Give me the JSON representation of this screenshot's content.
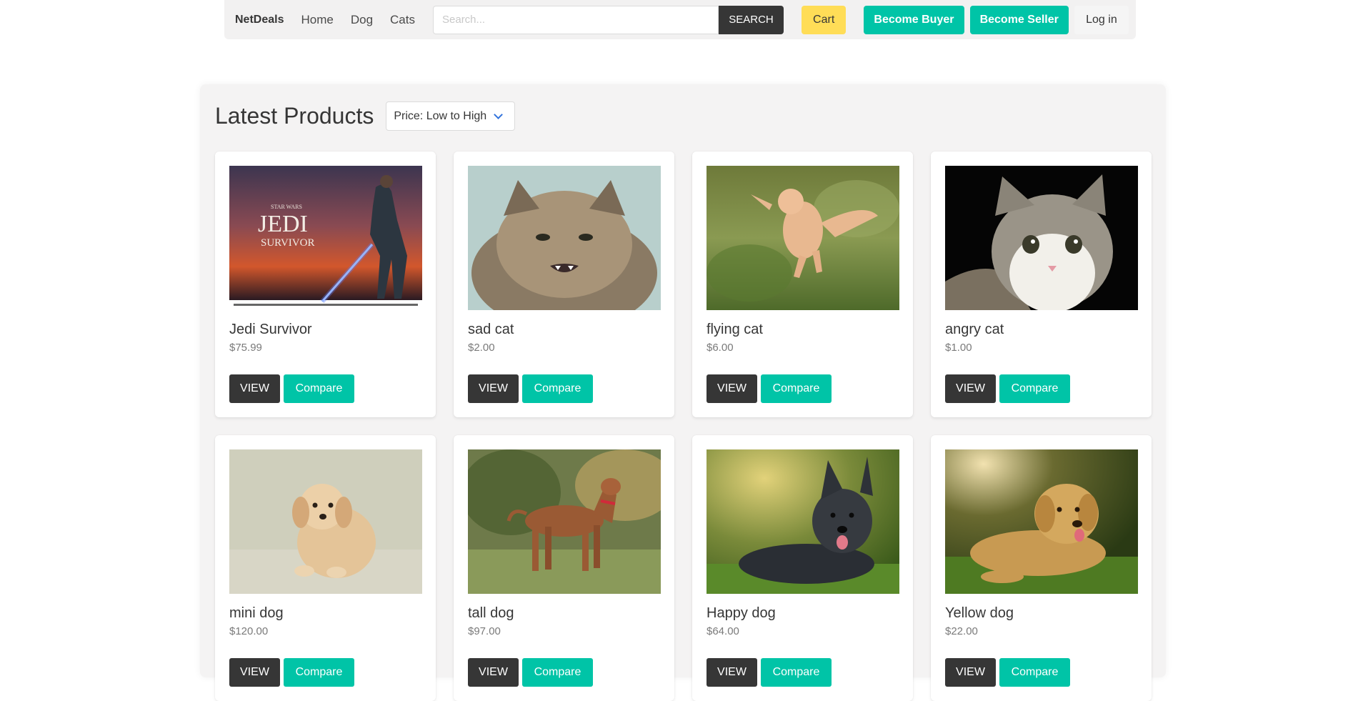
{
  "navbar": {
    "brand": "NetDeals",
    "links": [
      "Home",
      "Dog",
      "Cats"
    ],
    "search_placeholder": "Search...",
    "search_button": "SEARCH",
    "cart": "Cart",
    "become_buyer": "Become Buyer",
    "become_seller": "Become Seller",
    "login": "Log in"
  },
  "products_section": {
    "title": "Latest Products",
    "sort_selected": "Price: Low to High"
  },
  "product_buttons": {
    "view": "VIEW",
    "compare": "Compare"
  },
  "products": [
    {
      "name": "Jedi Survivor",
      "price": "$75.99",
      "image": "jedi-survivor-game-cover"
    },
    {
      "name": "sad cat",
      "price": "$2.00",
      "image": "fluffy-grumpy-cat-photo"
    },
    {
      "name": "flying cat",
      "price": "$6.00",
      "image": "jumping-orange-cat-photo"
    },
    {
      "name": "angry cat",
      "price": "$1.00",
      "image": "tabby-cat-black-background-photo"
    },
    {
      "name": "mini dog",
      "price": "$120.00",
      "image": "golden-puppy-photo"
    },
    {
      "name": "tall dog",
      "price": "$97.00",
      "image": "brown-standing-dog-photo"
    },
    {
      "name": "Happy dog",
      "price": "$64.00",
      "image": "black-shepherd-dog-photo"
    },
    {
      "name": "Yellow dog",
      "price": "$22.00",
      "image": "golden-retriever-grass-photo"
    }
  ],
  "colors": {
    "primary_teal": "#00c4a7",
    "dark": "#363636",
    "cart_yellow": "#ffdd57",
    "panel_bg": "#f4f3f3"
  }
}
